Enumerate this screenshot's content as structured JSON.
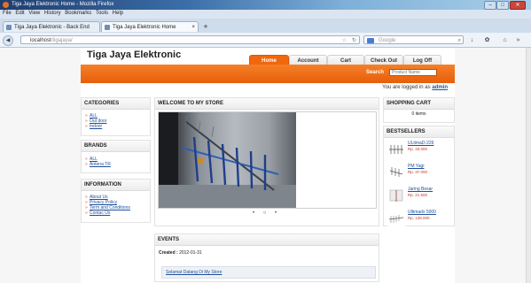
{
  "window": {
    "title": "Tiga Jaya Elektronic Home - Mozilla Firefox"
  },
  "menu": [
    "File",
    "Edit",
    "View",
    "History",
    "Bookmarks",
    "Tools",
    "Help"
  ],
  "tabs": [
    {
      "label": "Tiga Jaya Elektronic - Back End Store ..."
    },
    {
      "label": "Tiga Jaya Elektronic Home"
    }
  ],
  "address": {
    "host": "localhost",
    "path": "/tigajaya/"
  },
  "search_bar": {
    "placeholder": "Google"
  },
  "site": {
    "brand": "Tiga Jaya Elektronic",
    "nav": [
      "Home",
      "Account",
      "Cart",
      "Check Out",
      "Log Off"
    ],
    "search_label": "Search",
    "search_placeholder": "Product Name",
    "logged_in_text": "You are logged in as",
    "logged_in_user": "admin"
  },
  "categories": {
    "title": "CATEGORIES",
    "items": [
      "ALL",
      "Out door",
      "Indoor"
    ]
  },
  "brands": {
    "title": "BRANDS",
    "items": [
      "ALL",
      "Antena TR"
    ]
  },
  "information": {
    "title": "INFORMATION",
    "items": [
      "About Us",
      "Privacy Policy",
      "Term and Conditions",
      "Contac Us"
    ]
  },
  "welcome": {
    "title": "WELCOME TO MY STORE",
    "slider_dots": "• ○ •"
  },
  "events": {
    "title": "EVENTS",
    "created_label": "Created :",
    "created_date": "2012-01-31",
    "item": "Selamat Datang Di My Store"
  },
  "cart": {
    "title": "SHOPPING CART",
    "count": "0 items"
  },
  "bestsellers": {
    "title": "BESTSELLERS",
    "items": [
      {
        "name": "ULtimaD-226",
        "price": "Rp. 33.000"
      },
      {
        "name": "PM Yagi",
        "price": "Rp. 37.000"
      },
      {
        "name": "Jaring Besar",
        "price": "Rp. 21.500"
      },
      {
        "name": "Ultimadx 5000",
        "price": "Rp. 128.000"
      }
    ]
  },
  "colors": {
    "accent": "#f1670d",
    "link": "#1f4f9a"
  }
}
